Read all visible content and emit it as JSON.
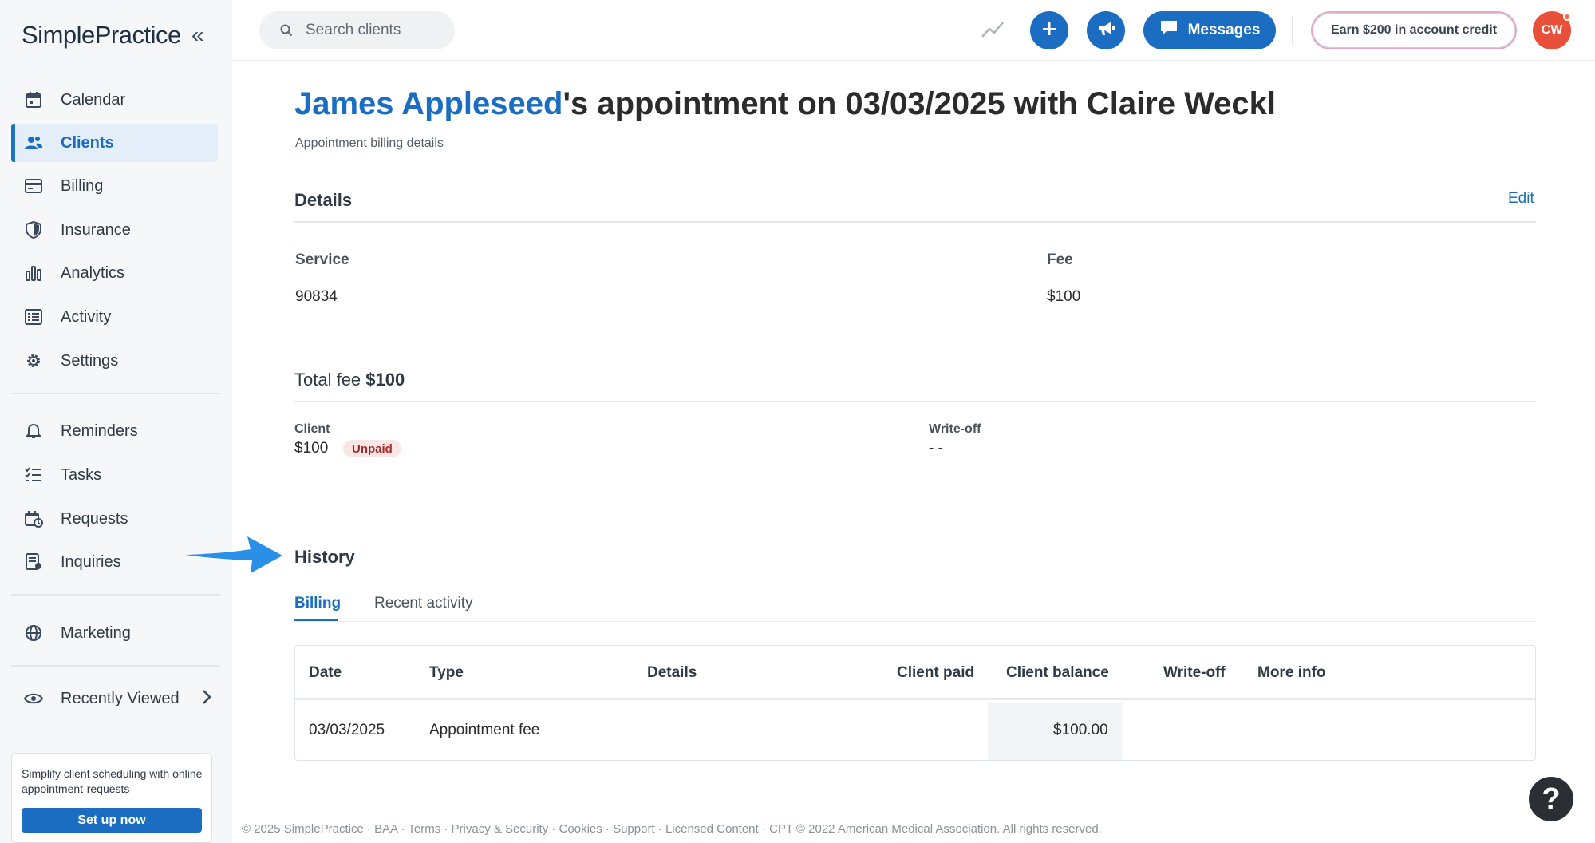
{
  "sidebar": {
    "logo": "SimplePractice",
    "nav_main": [
      {
        "label": "Calendar",
        "icon": "calendar-icon"
      },
      {
        "label": "Clients",
        "icon": "clients-icon",
        "active": true
      },
      {
        "label": "Billing",
        "icon": "credit-card-icon"
      },
      {
        "label": "Insurance",
        "icon": "shield-icon"
      },
      {
        "label": "Analytics",
        "icon": "bar-chart-icon"
      },
      {
        "label": "Activity",
        "icon": "list-icon"
      },
      {
        "label": "Settings",
        "icon": "gear-icon"
      }
    ],
    "nav_secondary": [
      {
        "label": "Reminders",
        "icon": "bell-icon"
      },
      {
        "label": "Tasks",
        "icon": "checklist-icon"
      },
      {
        "label": "Requests",
        "icon": "calendar-request-icon"
      },
      {
        "label": "Inquiries",
        "icon": "inquiry-icon"
      }
    ],
    "marketing": {
      "label": "Marketing",
      "icon": "globe-icon"
    },
    "recently_viewed": {
      "label": "Recently Viewed",
      "icon": "eye-icon"
    },
    "promo": {
      "text": "Simplify client scheduling with online appointment-requests",
      "button": "Set up now"
    }
  },
  "topbar": {
    "search_placeholder": "Search clients",
    "messages_label": "Messages",
    "earn_label": "Earn $200 in account credit",
    "avatar_initials": "CW"
  },
  "page": {
    "client_name": "James Appleseed",
    "title_rest": "'s appointment on 03/03/2025 with Claire Weckl",
    "subtitle": "Appointment billing details"
  },
  "details": {
    "title": "Details",
    "edit_label": "Edit",
    "service_label": "Service",
    "service_value": "90834",
    "fee_label": "Fee",
    "fee_value": "$100"
  },
  "total": {
    "label": "Total fee",
    "amount": "$100",
    "client_label": "Client",
    "client_value": "$100",
    "status_badge": "Unpaid",
    "writeoff_label": "Write-off",
    "writeoff_value": "- -"
  },
  "history": {
    "title": "History",
    "tabs": [
      "Billing",
      "Recent activity"
    ],
    "columns": [
      "Date",
      "Type",
      "Details",
      "Client paid",
      "Client balance",
      "Write-off",
      "More info"
    ],
    "rows": [
      {
        "date": "03/03/2025",
        "type": "Appointment fee",
        "details": "",
        "client_paid": "",
        "client_balance": "$100.00",
        "write_off": "",
        "more_info": ""
      }
    ]
  },
  "footer": "© 2025 SimplePractice · BAA · Terms · Privacy & Security · Cookies · Support · Licensed Content · CPT © 2022 American Medical Association. All rights reserved.",
  "help_label": "?",
  "colors": {
    "brand_blue": "#1a6dc0",
    "avatar_red": "#e8503a",
    "arrow_blue": "#2a8fe6",
    "unpaid_red": "#a22a2a"
  }
}
